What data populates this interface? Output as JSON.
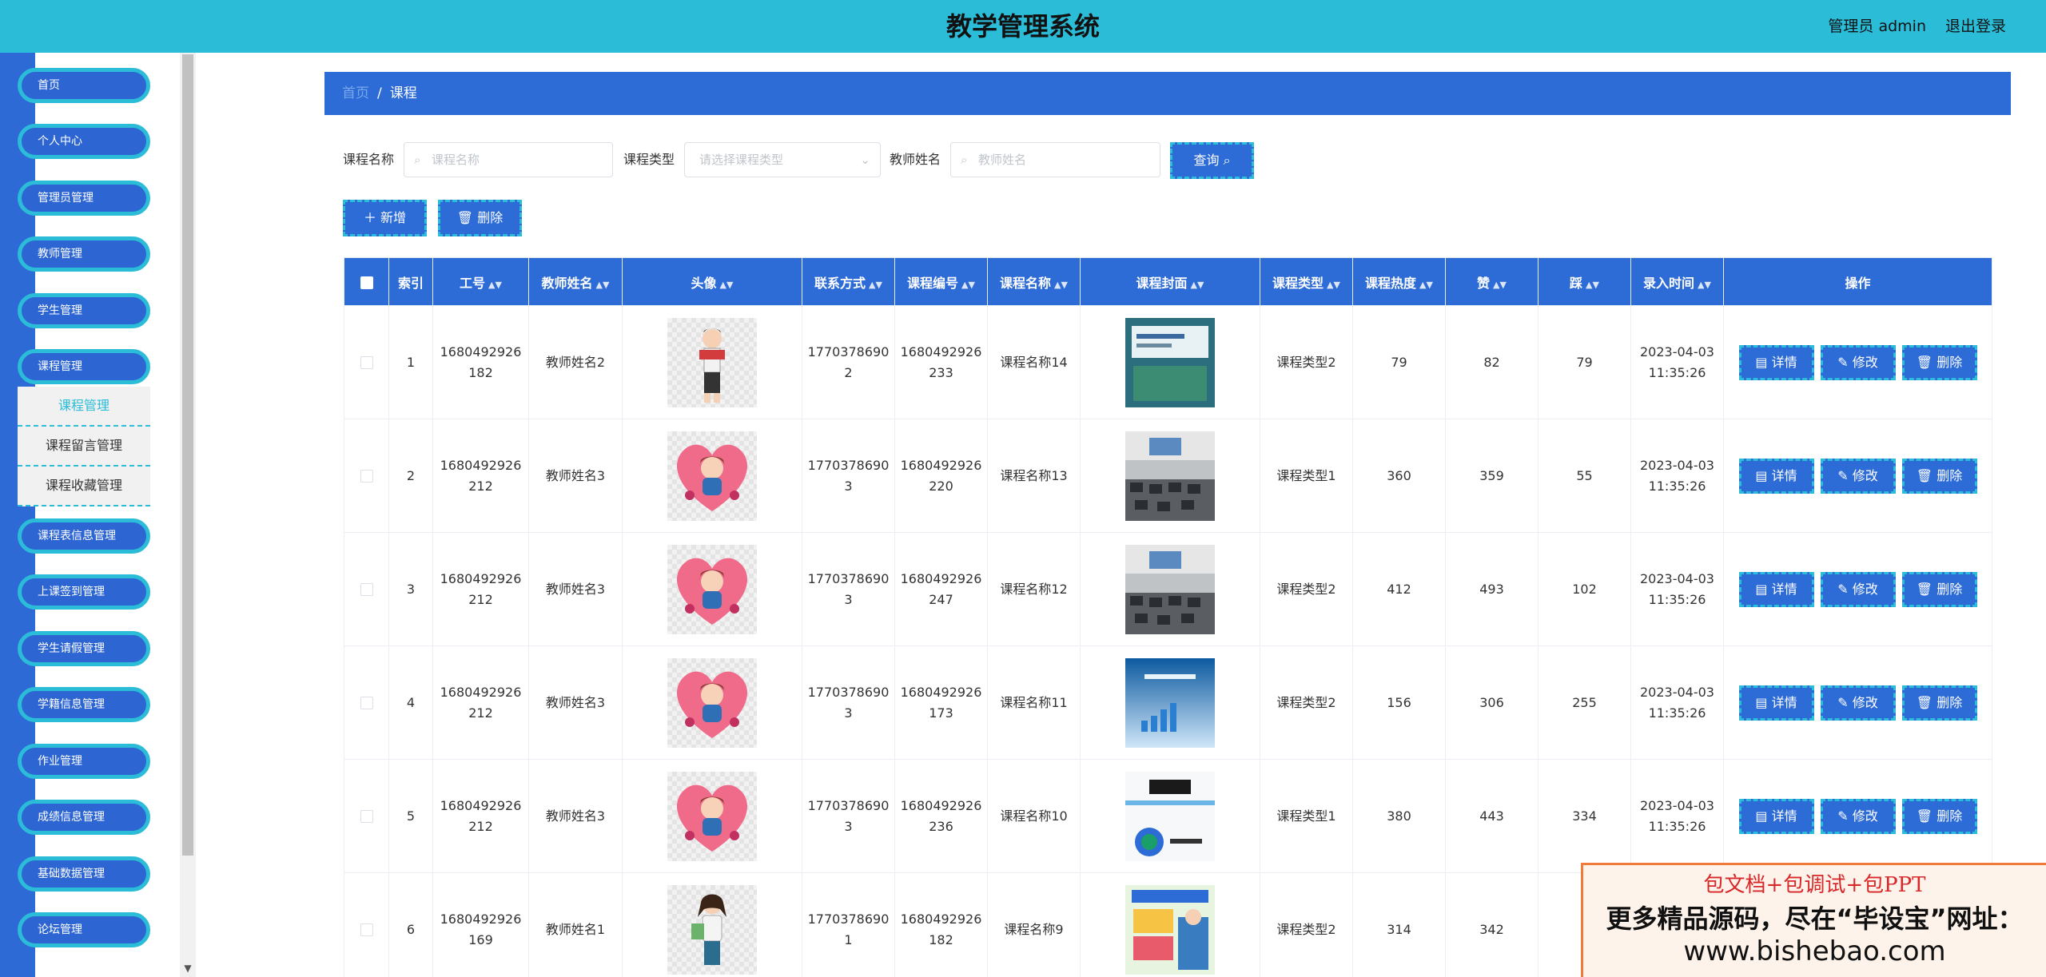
{
  "header": {
    "title": "教学管理系统",
    "user": "管理员 admin",
    "logout": "退出登录"
  },
  "sidebar": {
    "items": [
      "首页",
      "个人中心",
      "管理员管理",
      "教师管理",
      "学生管理",
      "课程管理",
      "课程表信息管理",
      "上课签到管理",
      "学生请假管理",
      "学籍信息管理",
      "作业管理",
      "成绩信息管理",
      "基础数据管理",
      "论坛管理"
    ],
    "submenu": [
      "课程管理",
      "课程留言管理",
      "课程收藏管理"
    ]
  },
  "breadcrumb": {
    "home": "首页",
    "current": "课程"
  },
  "search": {
    "course_name_label": "课程名称",
    "course_name_placeholder": "课程名称",
    "course_type_label": "课程类型",
    "course_type_placeholder": "请选择课程类型",
    "teacher_name_label": "教师姓名",
    "teacher_name_placeholder": "教师姓名",
    "query_button": "查询"
  },
  "actions": {
    "add": "新增",
    "delete": "删除"
  },
  "table": {
    "headers": [
      "索引",
      "工号",
      "教师姓名",
      "头像",
      "联系方式",
      "课程编号",
      "课程名称",
      "课程封面",
      "课程类型",
      "课程热度",
      "赞",
      "踩",
      "录入时间",
      "操作"
    ],
    "op_labels": {
      "detail": "详情",
      "edit": "修改",
      "delete": "删除"
    },
    "rows": [
      {
        "idx": "1",
        "job_a": "1680492926",
        "job_b": "182",
        "teacher": "教师姓名2",
        "phone_a": "1770378690",
        "phone_b": "2",
        "code_a": "1680492926",
        "code_b": "233",
        "course": "课程名称14",
        "type": "课程类型2",
        "heat": "79",
        "like": "82",
        "dislike": "79",
        "date": "2023-04-03",
        "time": "11:35:26",
        "avatar": "reader",
        "cover": "book"
      },
      {
        "idx": "2",
        "job_a": "1680492926",
        "job_b": "212",
        "teacher": "教师姓名3",
        "phone_a": "1770378690",
        "phone_b": "3",
        "code_a": "1680492926",
        "code_b": "220",
        "course": "课程名称13",
        "type": "课程类型1",
        "heat": "360",
        "like": "359",
        "dislike": "55",
        "date": "2023-04-03",
        "time": "11:35:26",
        "avatar": "heart",
        "cover": "classroom"
      },
      {
        "idx": "3",
        "job_a": "1680492926",
        "job_b": "212",
        "teacher": "教师姓名3",
        "phone_a": "1770378690",
        "phone_b": "3",
        "code_a": "1680492926",
        "code_b": "247",
        "course": "课程名称12",
        "type": "课程类型2",
        "heat": "412",
        "like": "493",
        "dislike": "102",
        "date": "2023-04-03",
        "time": "11:35:26",
        "avatar": "heart",
        "cover": "classroom"
      },
      {
        "idx": "4",
        "job_a": "1680492926",
        "job_b": "212",
        "teacher": "教师姓名3",
        "phone_a": "1770378690",
        "phone_b": "3",
        "code_a": "1680492926",
        "code_b": "173",
        "course": "课程名称11",
        "type": "课程类型2",
        "heat": "156",
        "like": "306",
        "dislike": "255",
        "date": "2023-04-03",
        "time": "11:35:26",
        "avatar": "heart",
        "cover": "blue"
      },
      {
        "idx": "5",
        "job_a": "1680492926",
        "job_b": "212",
        "teacher": "教师姓名3",
        "phone_a": "1770378690",
        "phone_b": "3",
        "code_a": "1680492926",
        "code_b": "236",
        "course": "课程名称10",
        "type": "课程类型1",
        "heat": "380",
        "like": "443",
        "dislike": "334",
        "date": "2023-04-03",
        "time": "11:35:26",
        "avatar": "heart",
        "cover": "physics"
      },
      {
        "idx": "6",
        "job_a": "1680492926",
        "job_b": "169",
        "teacher": "教师姓名1",
        "phone_a": "1770378690",
        "phone_b": "1",
        "code_a": "1680492926",
        "code_b": "182",
        "course": "课程名称9",
        "type": "课程类型2",
        "heat": "314",
        "like": "342",
        "dislike": "",
        "date": "",
        "time": "",
        "avatar": "girl",
        "cover": "poster"
      }
    ]
  },
  "watermark": {
    "line1": "包文档+包调试+包PPT",
    "line2": "更多精品源码，尽在“毕设宝”网址：",
    "line3": "www.bishebao.com"
  },
  "colors": {
    "header": "#2bbcd8",
    "primary": "#2d6bd6",
    "accent": "#2bbcd8"
  }
}
